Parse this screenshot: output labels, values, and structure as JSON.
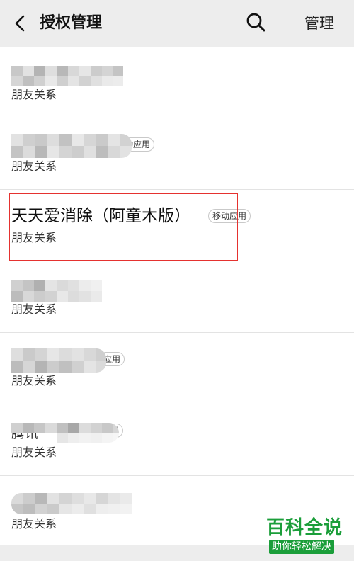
{
  "header": {
    "title": "授权管理",
    "manage_label": "管理"
  },
  "rows": [
    {
      "subtitle": "朋友关系"
    },
    {
      "badge": "动应用",
      "subtitle": "朋友关系"
    },
    {
      "name": "天天爱消除（阿童木版）",
      "badge": "移动应用",
      "subtitle": "朋友关系"
    },
    {
      "subtitle": "朋友关系"
    },
    {
      "badge": "应用",
      "subtitle": "朋友关系"
    },
    {
      "name_partial": "腾讯",
      "badge": "用",
      "subtitle": "朋友关系"
    },
    {
      "subtitle": "朋友关系"
    }
  ],
  "watermark": {
    "main": "百科全说",
    "sub": "助你轻松解决"
  },
  "colors": {
    "highlight": "#e5322f",
    "watermark": "#1b9e3a",
    "background": "#ededed"
  }
}
